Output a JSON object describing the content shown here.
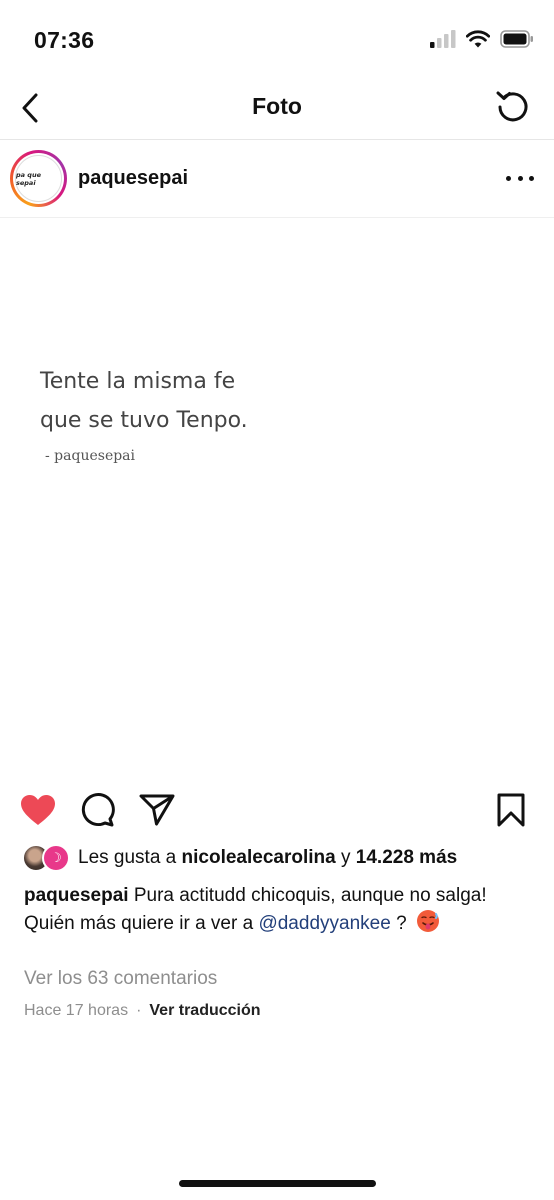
{
  "status_bar": {
    "time": "07:36"
  },
  "nav": {
    "title": "Foto"
  },
  "post": {
    "username": "paquesepai",
    "avatar_text": "pa que sepai",
    "photo_text": {
      "line1": "Tente la misma fe",
      "line2": "que se tuvo Tenpo.",
      "signature": "- paquesepai"
    },
    "liked": true,
    "likes": {
      "prefix": "Les gusta a",
      "user": "nicolealecarolina",
      "connector": "y",
      "count": "14.228 más"
    },
    "caption": {
      "username": "paquesepai",
      "text": "Pura actitudd chicoquis, aunque no salga!",
      "line2_before": "Quién más quiere ir a ver a",
      "mention": "@daddyyankee",
      "line2_after": "?"
    },
    "view_comments": "Ver los 63 comentarios",
    "time_ago": "Hace 17 horas",
    "separator": "·",
    "translate": "Ver traducción"
  },
  "colors": {
    "like_red": "#ed4956",
    "mention_blue": "#223f7a",
    "muted": "#8e8e8e"
  },
  "icons": [
    "back-chevron",
    "refresh",
    "more-dots",
    "heart",
    "comment",
    "share",
    "bookmark"
  ]
}
